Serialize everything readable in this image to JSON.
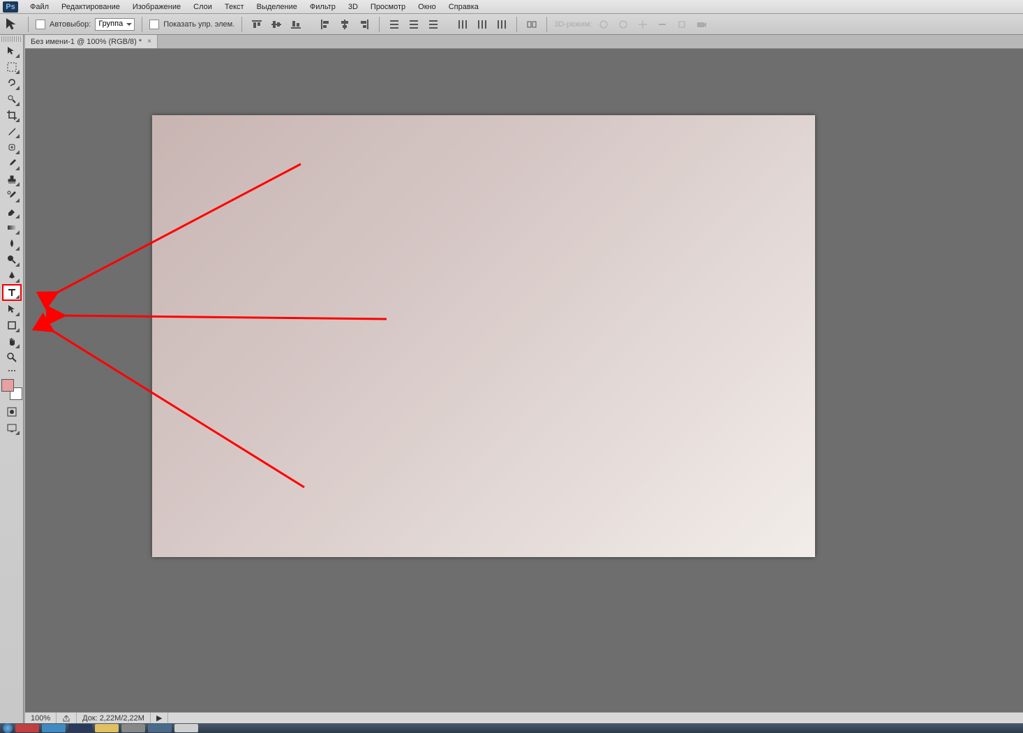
{
  "app": {
    "logo": "Ps"
  },
  "menu": [
    "Файл",
    "Редактирование",
    "Изображение",
    "Слои",
    "Текст",
    "Выделение",
    "Фильтр",
    "3D",
    "Просмотр",
    "Окно",
    "Справка"
  ],
  "options": {
    "autoselect_label": "Автовыбор:",
    "group_value": "Группа",
    "show_controls_label": "Показать упр. элем.",
    "mode3d_label": "3D-режим:"
  },
  "document_tab": {
    "title": "Без имени-1 @ 100% (RGB/8) *",
    "close": "×"
  },
  "colors": {
    "foreground": "#e8a0a0",
    "background": "#ffffff"
  },
  "status": {
    "zoom": "100%",
    "doc_size": "Док: 2,22M/2,22M"
  },
  "tools": [
    {
      "id": "move",
      "title": "Move"
    },
    {
      "id": "marquee",
      "title": "Marquee"
    },
    {
      "id": "lasso",
      "title": "Lasso"
    },
    {
      "id": "wand",
      "title": "Magic Wand"
    },
    {
      "id": "crop",
      "title": "Crop"
    },
    {
      "id": "eyedrop",
      "title": "Eyedropper"
    },
    {
      "id": "heal",
      "title": "Healing"
    },
    {
      "id": "brush",
      "title": "Brush"
    },
    {
      "id": "stamp",
      "title": "Stamp"
    },
    {
      "id": "history",
      "title": "History Brush"
    },
    {
      "id": "eraser",
      "title": "Eraser"
    },
    {
      "id": "gradient",
      "title": "Gradient"
    },
    {
      "id": "blur",
      "title": "Blur"
    },
    {
      "id": "dodge",
      "title": "Dodge"
    },
    {
      "id": "pen",
      "title": "Pen"
    },
    {
      "id": "type",
      "title": "Type",
      "selected": true
    },
    {
      "id": "path",
      "title": "Path Selection"
    },
    {
      "id": "shape",
      "title": "Shape"
    },
    {
      "id": "hand",
      "title": "Hand"
    },
    {
      "id": "zoom",
      "title": "Zoom"
    }
  ]
}
